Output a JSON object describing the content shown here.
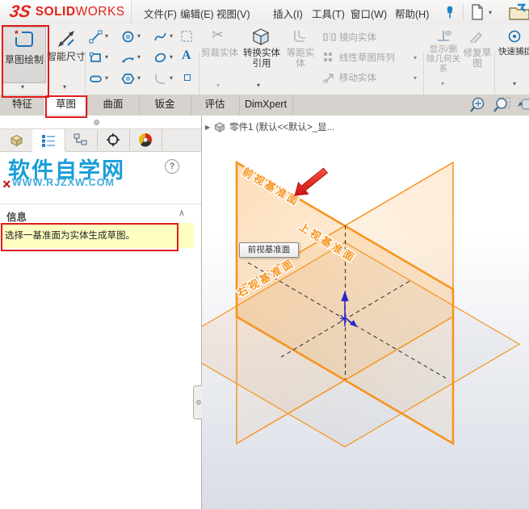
{
  "brand": {
    "mark": "3S",
    "bold": "SOLID",
    "light": "WORKS"
  },
  "menu_bar": {
    "items": [
      {
        "label": "文件(F)"
      },
      {
        "label": "编辑(E)"
      },
      {
        "label": "视图(V)"
      },
      {
        "label": "插入(I)"
      },
      {
        "label": "工具(T)"
      },
      {
        "label": "窗口(W)"
      },
      {
        "label": "帮助(H)"
      }
    ]
  },
  "ribbon": {
    "sketch_button": {
      "label": "草图绘制"
    },
    "smart_dimension": {
      "label": "智能尺寸"
    },
    "trim": {
      "label": "剪裁实体"
    },
    "convert": {
      "label": "转换实体引用"
    },
    "offset": {
      "label": "等距实体"
    },
    "mirror": {
      "label": "镜向实体"
    },
    "linear_pattern": {
      "label": "线性草图阵列"
    },
    "move": {
      "label": "移动实体"
    },
    "relations": {
      "label": "显示/删除几何关系"
    },
    "repair": {
      "label": "修复草图"
    },
    "quick_snaps": {
      "label": "快速捕捉"
    }
  },
  "tab_bar": {
    "active_tab": "草图",
    "tabs": [
      {
        "label": "特征"
      },
      {
        "label": "草图"
      },
      {
        "label": "曲面"
      },
      {
        "label": "钣金"
      },
      {
        "label": "评估"
      },
      {
        "label": "DimXpert"
      }
    ]
  },
  "left_panel": {
    "watermark_title": "软件自学网",
    "watermark_url": "WWW.RJZXW.COM",
    "info_header": "信息",
    "message": "选择一基准面为实体生成草图。"
  },
  "viewport": {
    "tree_item": "零件1 (默认<<默认>_显...",
    "tooltip": "前视基准面",
    "plane_front": "前视基准面",
    "plane_top": "上视基准面",
    "plane_right": "右视基准面"
  },
  "glyphs": {
    "caret": "▾",
    "chevron_collapse": "∧",
    "close": "×",
    "help": "?",
    "tree_expand": "▶",
    "scissors": "✂",
    "text_tool": "A",
    "asterisk": "*"
  },
  "colors": {
    "accent_orange": "#F7941E",
    "annotation_red": "#E21B1B",
    "brand_red": "#E2231A",
    "watermark_blue": "#189FD8",
    "message_bg": "#FFFFC2",
    "origin_blue": "#2525CD"
  }
}
